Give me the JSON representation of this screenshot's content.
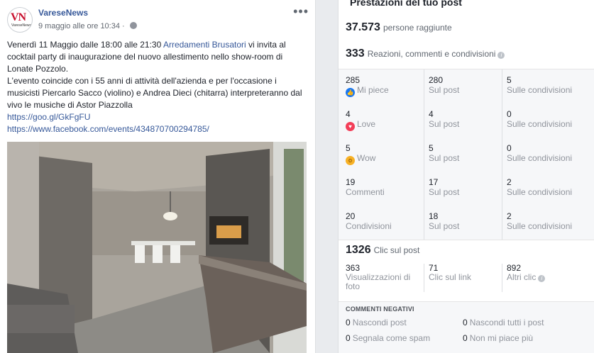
{
  "post": {
    "page_name": "VareseNews",
    "avatar_text": "VN",
    "avatar_sub": "VareseNews",
    "date": "9 maggio alle ore 10:34 ·",
    "text_line1_a": "Venerdì 11 Maggio dalle 18:00 alle 21:30 ",
    "text_line1_link": "Arredamenti Brusatori",
    "text_line1_b": " vi invita al cocktail party di inaugurazione del nuovo allestimento nello show-room di Lonate Pozzolo.",
    "text_para2": "L'evento coincide con i 55 anni di attività dell'azienda e per l'occasione i musicisti Piercarlo Sacco (violino) e Andrea Dieci (chitarra) interpreteranno dal vivo le musiche di Astor Piazzolla",
    "link1": "https://goo.gl/GkFgFU",
    "link2": "https://www.facebook.com/events/434870700294785/"
  },
  "stats": {
    "title": "Prestazioni del tuo post",
    "reach_value": "37.573",
    "reach_label": "persone raggiunte",
    "engagement_value": "333",
    "engagement_label": "Reazioni, commenti e condivisioni",
    "rows": [
      {
        "total": "285",
        "label": "Mi piece",
        "icon": "like-icon",
        "on_post": "280",
        "on_post_label": "Sul post",
        "on_shares": "5",
        "on_shares_label": "Sulle condivisioni"
      },
      {
        "total": "4",
        "label": "Love",
        "icon": "love-icon",
        "on_post": "4",
        "on_post_label": "Sul post",
        "on_shares": "0",
        "on_shares_label": "Sulle condivisioni"
      },
      {
        "total": "5",
        "label": "Wow",
        "icon": "wow-icon",
        "on_post": "5",
        "on_post_label": "Sul post",
        "on_shares": "0",
        "on_shares_label": "Sulle condivisioni"
      },
      {
        "total": "19",
        "label": "Commenti",
        "on_post": "17",
        "on_post_label": "Sul post",
        "on_shares": "2",
        "on_shares_label": "Sulle condivisioni"
      },
      {
        "total": "20",
        "label": "Condivisioni",
        "on_post": "18",
        "on_post_label": "Sul post",
        "on_shares": "2",
        "on_shares_label": "Sulle condivisioni"
      }
    ],
    "clicks_value": "1326",
    "clicks_label": "Clic sul post",
    "photo_views": "363",
    "photo_views_label_1": "Visualizzazioni di",
    "photo_views_label_2": "foto",
    "link_clicks": "71",
    "link_clicks_label": "Clic sul link",
    "other_clicks": "892",
    "other_clicks_label": "Altri clic",
    "negative_title": "COMMENTI NEGATIVI",
    "hide_post": "0",
    "hide_post_label": "Nascondi post",
    "hide_all": "0",
    "hide_all_label": "Nascondi tutti i post",
    "report_spam": "0",
    "report_spam_label": "Segnala come spam",
    "unlike_page": "0",
    "unlike_page_label": "Non mi piace più"
  }
}
